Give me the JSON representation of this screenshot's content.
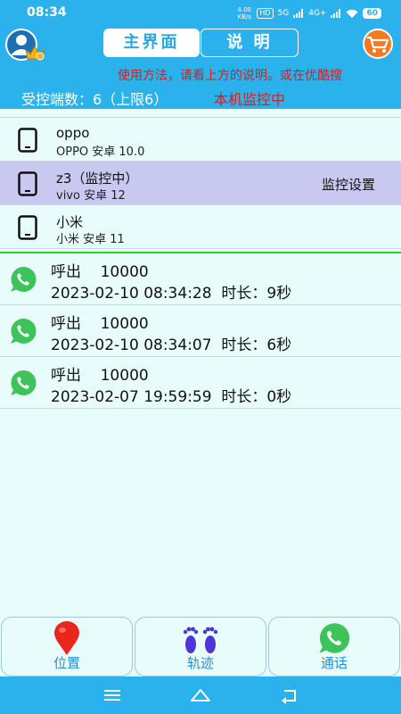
{
  "status_bar": {
    "time": "08:34",
    "net_speed": "4.00 KB/s",
    "hd_badge": "HD",
    "signal1": "5G",
    "signal2": "4G+",
    "battery": "60"
  },
  "header": {
    "tab_main": "主界面",
    "tab_help": "说 明",
    "marquee": "使用方法，请看上方的说明。或在优酷搜",
    "controlled_count": "受控端数：6（上限6）",
    "local_status": "本机监控中"
  },
  "devices": [
    {
      "name": "oppo",
      "sub": "OPPO 安卓 10.0",
      "action": "",
      "selected": false
    },
    {
      "name": "z3（监控中）",
      "sub": "vivo 安卓 12",
      "action": "监控设置",
      "selected": true
    },
    {
      "name": "小米",
      "sub": "小米 安卓 11",
      "action": "",
      "selected": false
    }
  ],
  "calls": [
    {
      "line1": "呼出    10000",
      "line2": "2023-02-10 08:34:28  时长：9秒"
    },
    {
      "line1": "呼出    10000",
      "line2": "2023-02-10 08:34:07  时长：6秒"
    },
    {
      "line1": "呼出    10000",
      "line2": "2023-02-07 19:59:59  时长：0秒"
    }
  ],
  "bottom_tabs": {
    "location": "位置",
    "track": "轨迹",
    "call": "通话"
  },
  "colors": {
    "primary": "#2bb2ec",
    "alert": "#e01b1b",
    "selected_row": "#c8c8f0",
    "background": "#e8fdfb",
    "divider_green": "#37c837",
    "whatsapp_green": "#3ec35a"
  }
}
